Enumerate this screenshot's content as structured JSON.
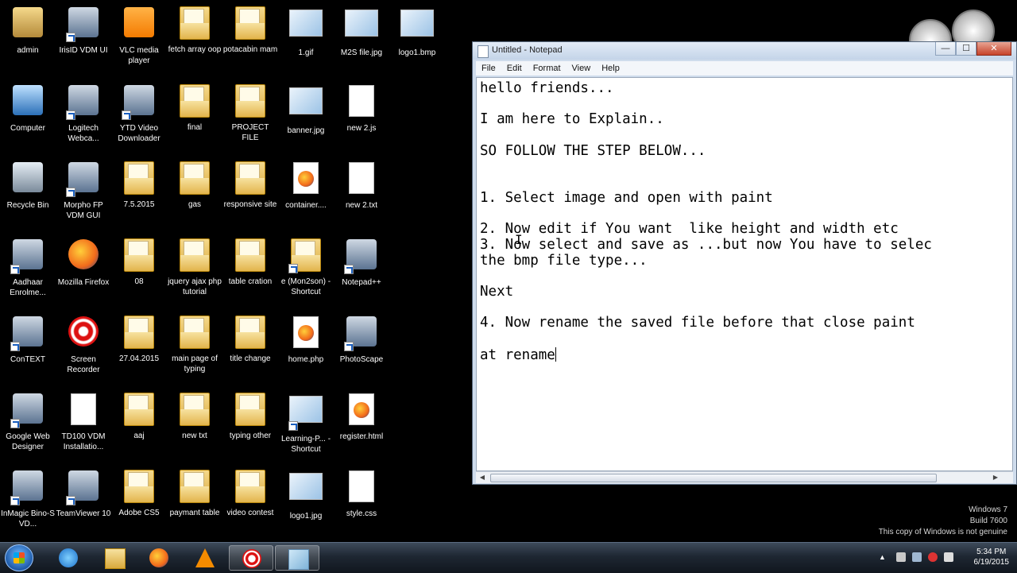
{
  "desktop": {
    "icons": [
      {
        "label": "admin",
        "kind": "user"
      },
      {
        "label": "IrisID VDM UI",
        "kind": "app"
      },
      {
        "label": "VLC media player",
        "kind": "vlc"
      },
      {
        "label": "fetch array oop",
        "kind": "folder"
      },
      {
        "label": "potacabin mam",
        "kind": "folder"
      },
      {
        "label": "1.gif",
        "kind": "image"
      },
      {
        "label": "M2S file.jpg",
        "kind": "image"
      },
      {
        "label": "logo1.bmp",
        "kind": "image"
      },
      {
        "label": "Computer",
        "kind": "computer"
      },
      {
        "label": "Logitech Webca...",
        "kind": "app"
      },
      {
        "label": "YTD Video Downloader",
        "kind": "app"
      },
      {
        "label": "final",
        "kind": "folder"
      },
      {
        "label": "PROJECT FILE",
        "kind": "folder"
      },
      {
        "label": "banner.jpg",
        "kind": "image"
      },
      {
        "label": "new 2.js",
        "kind": "doc"
      },
      {
        "label": "Recycle Bin",
        "kind": "recycle"
      },
      {
        "label": "Morpho FP VDM GUI",
        "kind": "app"
      },
      {
        "label": "7.5.2015",
        "kind": "folder"
      },
      {
        "label": "gas",
        "kind": "folder"
      },
      {
        "label": "responsive site",
        "kind": "folder"
      },
      {
        "label": "container....",
        "kind": "firefox-doc"
      },
      {
        "label": "new 2.txt",
        "kind": "doc"
      },
      {
        "label": "Aadhaar Enrolme...",
        "kind": "app"
      },
      {
        "label": "Mozilla Firefox",
        "kind": "firefox"
      },
      {
        "label": "08",
        "kind": "folder"
      },
      {
        "label": "jquery ajax php tutorial",
        "kind": "folder"
      },
      {
        "label": "table cration",
        "kind": "folder"
      },
      {
        "label": "e (Mon2son) - Shortcut",
        "kind": "folder"
      },
      {
        "label": "Notepad++",
        "kind": "app"
      },
      {
        "label": "ConTEXT",
        "kind": "app"
      },
      {
        "label": "Screen Recorder",
        "kind": "recorder"
      },
      {
        "label": "27.04.2015",
        "kind": "folder"
      },
      {
        "label": "main page of typing",
        "kind": "folder"
      },
      {
        "label": "title change",
        "kind": "folder"
      },
      {
        "label": "home.php",
        "kind": "firefox-doc"
      },
      {
        "label": "PhotoScape",
        "kind": "app"
      },
      {
        "label": "Google Web Designer",
        "kind": "app"
      },
      {
        "label": "TD100 VDM Installatio...",
        "kind": "doc"
      },
      {
        "label": "aaj",
        "kind": "folder"
      },
      {
        "label": "new txt",
        "kind": "folder"
      },
      {
        "label": "typing other",
        "kind": "folder"
      },
      {
        "label": "Learning-P... - Shortcut",
        "kind": "image"
      },
      {
        "label": "register.html",
        "kind": "firefox-doc"
      },
      {
        "label": "InMagic Bino-S VD...",
        "kind": "app"
      },
      {
        "label": "TeamViewer 10",
        "kind": "app"
      },
      {
        "label": "Adobe CS5",
        "kind": "folder"
      },
      {
        "label": "paymant table",
        "kind": "folder"
      },
      {
        "label": "video contest",
        "kind": "folder"
      },
      {
        "label": "logo1.jpg",
        "kind": "image"
      },
      {
        "label": "style.css",
        "kind": "doc"
      }
    ]
  },
  "notepad": {
    "title": "Untitled - Notepad",
    "menu": [
      "File",
      "Edit",
      "Format",
      "View",
      "Help"
    ],
    "buttons": {
      "minimize": "—",
      "maximize": "☐",
      "close": "✕"
    },
    "lines": [
      "hello friends...",
      "",
      "I am here to Explain..",
      "",
      "SO FOLLOW THE STEP BELOW...",
      "",
      "",
      "1. Select image and open with paint",
      "",
      "2. Now edit if You want  like height and width etc",
      "3. Now select and save as ...but now You have to selec",
      "the bmp file type...",
      "",
      "Next",
      "",
      "4. Now rename the saved file before that close paint",
      "",
      "at rename"
    ]
  },
  "watermark": {
    "line1": "Windows 7",
    "line2": "Build 7600",
    "line3": "This copy of Windows is not genuine"
  },
  "taskbar": {
    "clock_time": "5:34 PM",
    "clock_date": "6/19/2015"
  }
}
